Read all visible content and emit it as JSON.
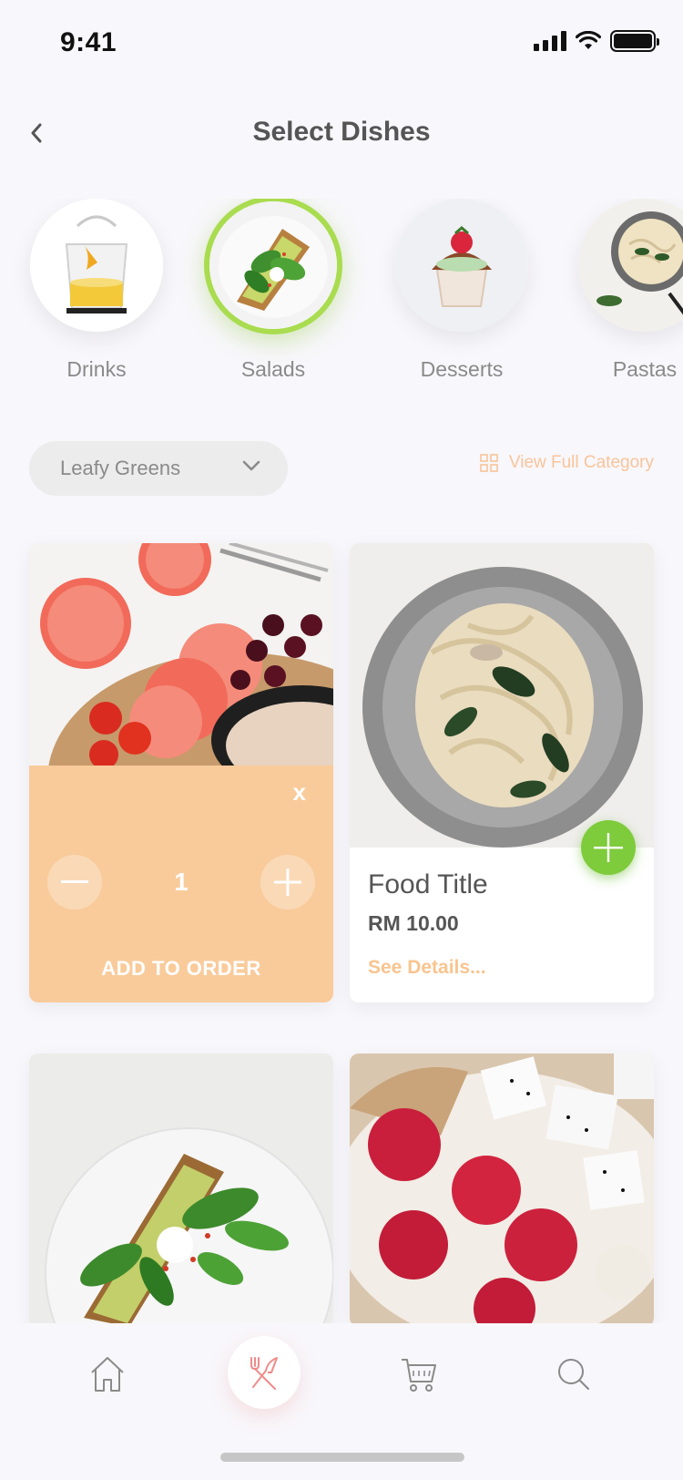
{
  "status_bar": {
    "time": "9:41"
  },
  "header": {
    "title": "Select Dishes"
  },
  "categories": [
    {
      "label": "Drinks",
      "selected": false
    },
    {
      "label": "Salads",
      "selected": true
    },
    {
      "label": "Desserts",
      "selected": false
    },
    {
      "label": "Pastas",
      "selected": false
    }
  ],
  "filter": {
    "selected": "Leafy Greens",
    "view_full_label": "View Full Category"
  },
  "order_panel": {
    "close_label": "x",
    "quantity": "1",
    "add_label": "ADD TO ORDER"
  },
  "food_card": {
    "title": "Food Title",
    "price": "RM 10.00",
    "details_label": "See Details..."
  },
  "colors": {
    "accent_orange": "#f9cb9b",
    "accent_green": "#7ecb3c",
    "selected_ring": "#a9dc4f",
    "nav_active": "#f08a8a"
  },
  "nav": {
    "active": "menu"
  }
}
